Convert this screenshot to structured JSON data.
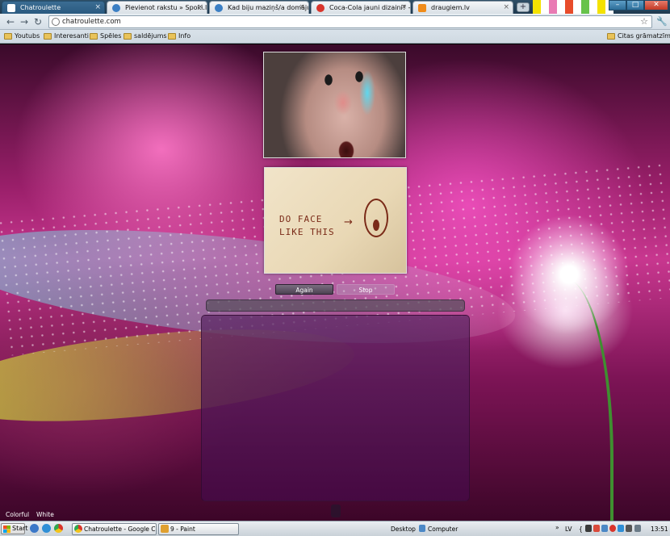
{
  "browser": {
    "tabs": [
      {
        "label": "Chatroulette",
        "active": true,
        "favicon_color": "#ffffff"
      },
      {
        "label": "Pievienot rakstu » Spoki.lv",
        "active": false,
        "favicon_color": "#3b7fc4"
      },
      {
        "label": "Kad biju maziņš/a domāju...",
        "active": false,
        "favicon_color": "#3b7fc4"
      },
      {
        "label": "Coca-Cola jauni dizaini? - ...",
        "active": false,
        "favicon_color": "#d9342b"
      },
      {
        "label": "draugiem.lv",
        "active": false,
        "favicon_color": "#f08c1a"
      }
    ],
    "tab_close_glyph": "×",
    "new_tab_glyph": "+",
    "address": "chatroulette.com",
    "window_buttons": {
      "minimize": "–",
      "maximize": "□",
      "close": "✕"
    },
    "nav": {
      "back": "←",
      "forward": "→",
      "reload": "↻",
      "star": "☆",
      "wrench": "🔧"
    },
    "bookmarks": [
      "Youtubs",
      "Interesanti",
      "Spēles",
      "saldējums",
      "Info"
    ],
    "other_bookmarks": "Citas grāmatzīmes"
  },
  "page": {
    "note_text": "DO FACE\nLIKE THIS",
    "again_label": "Again",
    "stop_label": "Stop",
    "themes": [
      "Colorful",
      "White"
    ]
  },
  "taskbar": {
    "start_label": "Start",
    "tasks": [
      {
        "label": "Chatroulette - Google C...",
        "icon_color": "#d9342b"
      },
      {
        "label": "9 - Paint",
        "icon_color": "#e0a030"
      }
    ],
    "desktop_label": "Desktop",
    "computer_label": "Computer",
    "lang": "LV",
    "time": "13:51",
    "expand_glyph": "»",
    "tray_separator": "{"
  }
}
